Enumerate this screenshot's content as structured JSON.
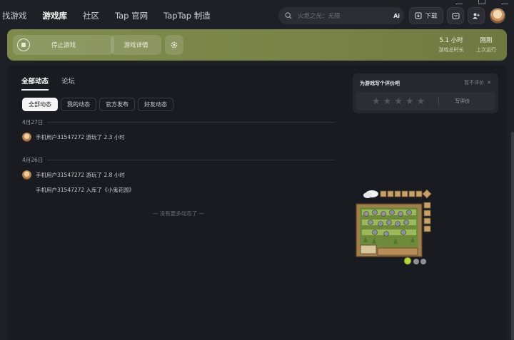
{
  "nav": {
    "items": [
      "找游戏",
      "游戏库",
      "社区",
      "Tap 官网",
      "TapTap 制造"
    ],
    "active_index": 1
  },
  "search": {
    "placeholder": "火炬之光：无限",
    "ai_label": "Ai"
  },
  "header": {
    "download_label": "下载"
  },
  "game_bar": {
    "stop_label": "停止游戏",
    "details_label": "游戏详情",
    "playtime_value": "5.1 小时",
    "playtime_label": "游戏总时长",
    "last_run_value": "刚刚",
    "last_run_label": "上次运行",
    "accent_color": "#7f8a4c"
  },
  "feed": {
    "tabs": [
      "全部动态",
      "论坛"
    ],
    "filters": [
      "全部动态",
      "我的动态",
      "官方发布",
      "好友动态"
    ],
    "groups": [
      {
        "date": "4月27日",
        "entries": [
          "手机用户31547272 游玩了 2.3 小时"
        ]
      },
      {
        "date": "4月26日",
        "entries": [
          "手机用户31547272 游玩了 2.8 小时",
          "手机用户31547272 入库了《小鬼花园》"
        ]
      }
    ],
    "no_more": "— 没有更多动态了 —"
  },
  "rating": {
    "title": "为游戏写个评价吧",
    "skip_label": "暂不评价",
    "stars": 5,
    "write_label": "写评价"
  }
}
